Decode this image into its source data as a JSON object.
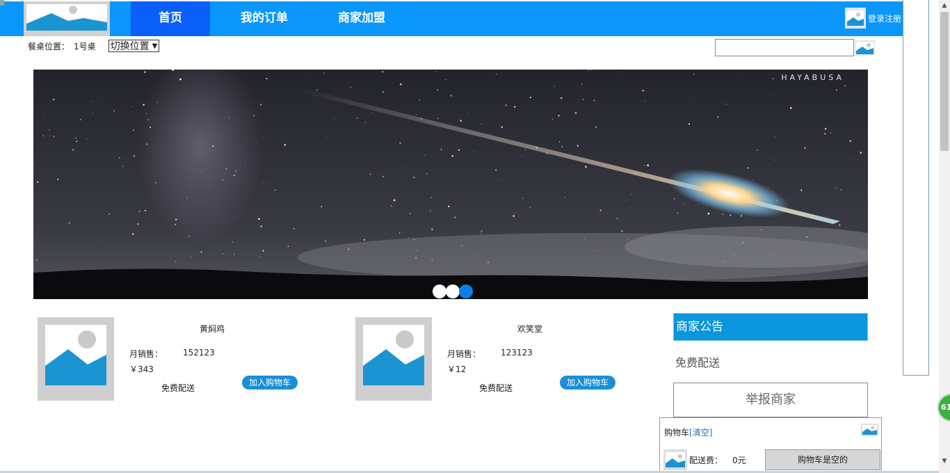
{
  "nav": {
    "items": [
      "首页",
      "我的订单",
      "商家加盟"
    ],
    "login": "登录注册",
    "logo_icon": "image-placeholder-icon",
    "color": "#0a96fa",
    "active_color": "#0a5ff8"
  },
  "seat": {
    "label": "餐桌位置：",
    "value": "1号桌",
    "switch_option": "切换位置"
  },
  "search": {
    "placeholder": "",
    "button_icon": "image-placeholder-icon"
  },
  "banner": {
    "caption": "HAYABUSA",
    "slide_count": 3,
    "active_slide": 3
  },
  "products": [
    {
      "name": "黄焖鸡",
      "sales_label": "月销售：",
      "sales": "152123",
      "price": "￥343",
      "delivery": "免费配送",
      "add_label": "加入购物车"
    },
    {
      "name": "欢笑堂",
      "sales_label": "月销售：",
      "sales": "123123",
      "price": "￥12",
      "delivery": "免费配送",
      "add_label": "加入购物车"
    }
  ],
  "notice": {
    "title": "商家公告",
    "text": "免费配送"
  },
  "report": {
    "label": "举报商家"
  },
  "cart": {
    "title": "购物车",
    "clear": "[清空]",
    "fee_label": "配送费：",
    "fee_value": "0元",
    "checkout": "购物车是空的"
  },
  "float_badge": "61"
}
